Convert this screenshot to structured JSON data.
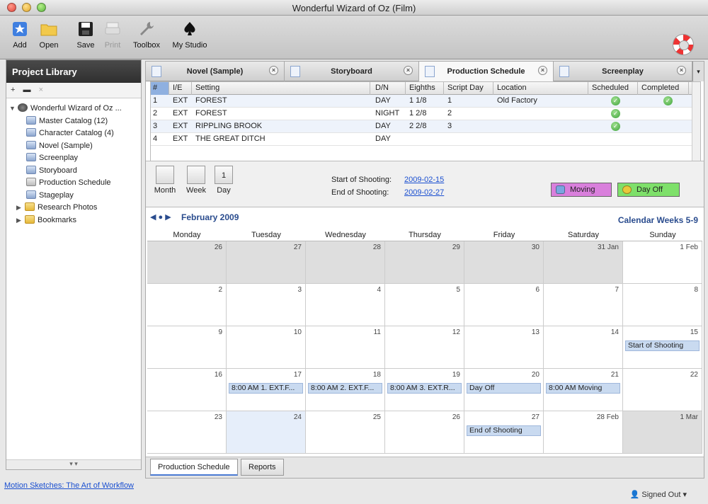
{
  "window": {
    "title": "Wonderful Wizard of Oz (Film)"
  },
  "toolbar": {
    "items": [
      {
        "label": "Add",
        "icon": "add-icon"
      },
      {
        "label": "Open",
        "icon": "folder-icon"
      },
      {
        "label": "Save",
        "icon": "save-icon"
      },
      {
        "label": "Print",
        "icon": "print-icon"
      },
      {
        "label": "Toolbox",
        "icon": "wrench-icon"
      },
      {
        "label": "My Studio",
        "icon": "spade-icon"
      }
    ]
  },
  "sidebar": {
    "title": "Project Library",
    "tree": [
      {
        "label": "Wonderful Wizard of Oz ...",
        "icon": "globe",
        "level": 0,
        "expanded": true
      },
      {
        "label": "Master Catalog (12)",
        "icon": "doc",
        "level": 1
      },
      {
        "label": "Character Catalog (4)",
        "icon": "doc",
        "level": 1
      },
      {
        "label": "Novel (Sample)",
        "icon": "doc",
        "level": 1
      },
      {
        "label": "Screenplay",
        "icon": "doc",
        "level": 1
      },
      {
        "label": "Storyboard",
        "icon": "doc",
        "level": 1
      },
      {
        "label": "Production Schedule",
        "icon": "sched",
        "level": 1
      },
      {
        "label": "Stageplay",
        "icon": "doc",
        "level": 1
      },
      {
        "label": "Research Photos",
        "icon": "folder",
        "level": 0,
        "expanded": false
      },
      {
        "label": "Bookmarks",
        "icon": "folder",
        "level": 0,
        "expanded": false
      }
    ]
  },
  "footer": {
    "link": "Motion Sketches: The Art of Workflow",
    "signout": "Signed Out"
  },
  "tabs": [
    {
      "label": "Novel (Sample)"
    },
    {
      "label": "Storyboard"
    },
    {
      "label": "Production Schedule"
    },
    {
      "label": "Screenplay"
    }
  ],
  "scenes": {
    "columns": [
      "#",
      "I/E",
      "Setting",
      "D/N",
      "Eighths",
      "Script Day",
      "Location",
      "Scheduled",
      "Completed"
    ],
    "rows": [
      {
        "num": "1",
        "ie": "EXT",
        "setting": "FOREST",
        "dn": "DAY",
        "eighths": "1 1/8",
        "scriptday": "1",
        "location": "Old Factory",
        "scheduled": true,
        "completed": true
      },
      {
        "num": "2",
        "ie": "EXT",
        "setting": "FOREST",
        "dn": "NIGHT",
        "eighths": "1 2/8",
        "scriptday": "2",
        "location": "",
        "scheduled": true,
        "completed": false
      },
      {
        "num": "3",
        "ie": "EXT",
        "setting": "RIPPLING BROOK",
        "dn": "DAY",
        "eighths": "2 2/8",
        "scriptday": "3",
        "location": "",
        "scheduled": true,
        "completed": false
      },
      {
        "num": "4",
        "ie": "EXT",
        "setting": "THE GREAT DITCH",
        "dn": "DAY",
        "eighths": "",
        "scriptday": "",
        "location": "",
        "scheduled": false,
        "completed": false
      }
    ]
  },
  "controls": {
    "views": [
      "Month",
      "Week",
      "Day"
    ],
    "day_icon": "1",
    "start_label": "Start of Shooting:",
    "start_value": "2009-02-15",
    "end_label": "End of Shooting:",
    "end_value": "2009-02-27",
    "badges": [
      {
        "label": "Moving",
        "color": "#d97fdc"
      },
      {
        "label": "Day Off",
        "color": "#7ee06a"
      }
    ]
  },
  "calendar": {
    "month": "February 2009",
    "weeks_label": "Calendar Weeks 5-9",
    "daynames": [
      "Monday",
      "Tuesday",
      "Wednesday",
      "Thursday",
      "Friday",
      "Saturday",
      "Sunday"
    ],
    "weeks": [
      [
        {
          "day": "26",
          "grey": true
        },
        {
          "day": "27",
          "grey": true
        },
        {
          "day": "28",
          "grey": true
        },
        {
          "day": "29",
          "grey": true
        },
        {
          "day": "30",
          "grey": true
        },
        {
          "day": "31 Jan",
          "grey": true
        },
        {
          "day": "1 Feb"
        }
      ],
      [
        {
          "day": "2"
        },
        {
          "day": "3"
        },
        {
          "day": "4"
        },
        {
          "day": "5"
        },
        {
          "day": "6"
        },
        {
          "day": "7"
        },
        {
          "day": "8"
        }
      ],
      [
        {
          "day": "9"
        },
        {
          "day": "10"
        },
        {
          "day": "11"
        },
        {
          "day": "12"
        },
        {
          "day": "13"
        },
        {
          "day": "14"
        },
        {
          "day": "15",
          "event": "Start of Shooting"
        }
      ],
      [
        {
          "day": "16"
        },
        {
          "day": "17",
          "event": "8:00 AM 1. EXT.F..."
        },
        {
          "day": "18",
          "event": "8:00 AM 2. EXT.F..."
        },
        {
          "day": "19",
          "event": "8:00 AM 3. EXT.R..."
        },
        {
          "day": "20",
          "event": "Day Off"
        },
        {
          "day": "21",
          "event": "8:00 AM Moving"
        },
        {
          "day": "22"
        }
      ],
      [
        {
          "day": "23"
        },
        {
          "day": "24",
          "today": true
        },
        {
          "day": "25"
        },
        {
          "day": "26"
        },
        {
          "day": "27",
          "event": "End of Shooting"
        },
        {
          "day": "28 Feb"
        },
        {
          "day": "1 Mar",
          "grey": true
        }
      ]
    ]
  },
  "bottom_tabs": [
    "Production Schedule",
    "Reports"
  ]
}
